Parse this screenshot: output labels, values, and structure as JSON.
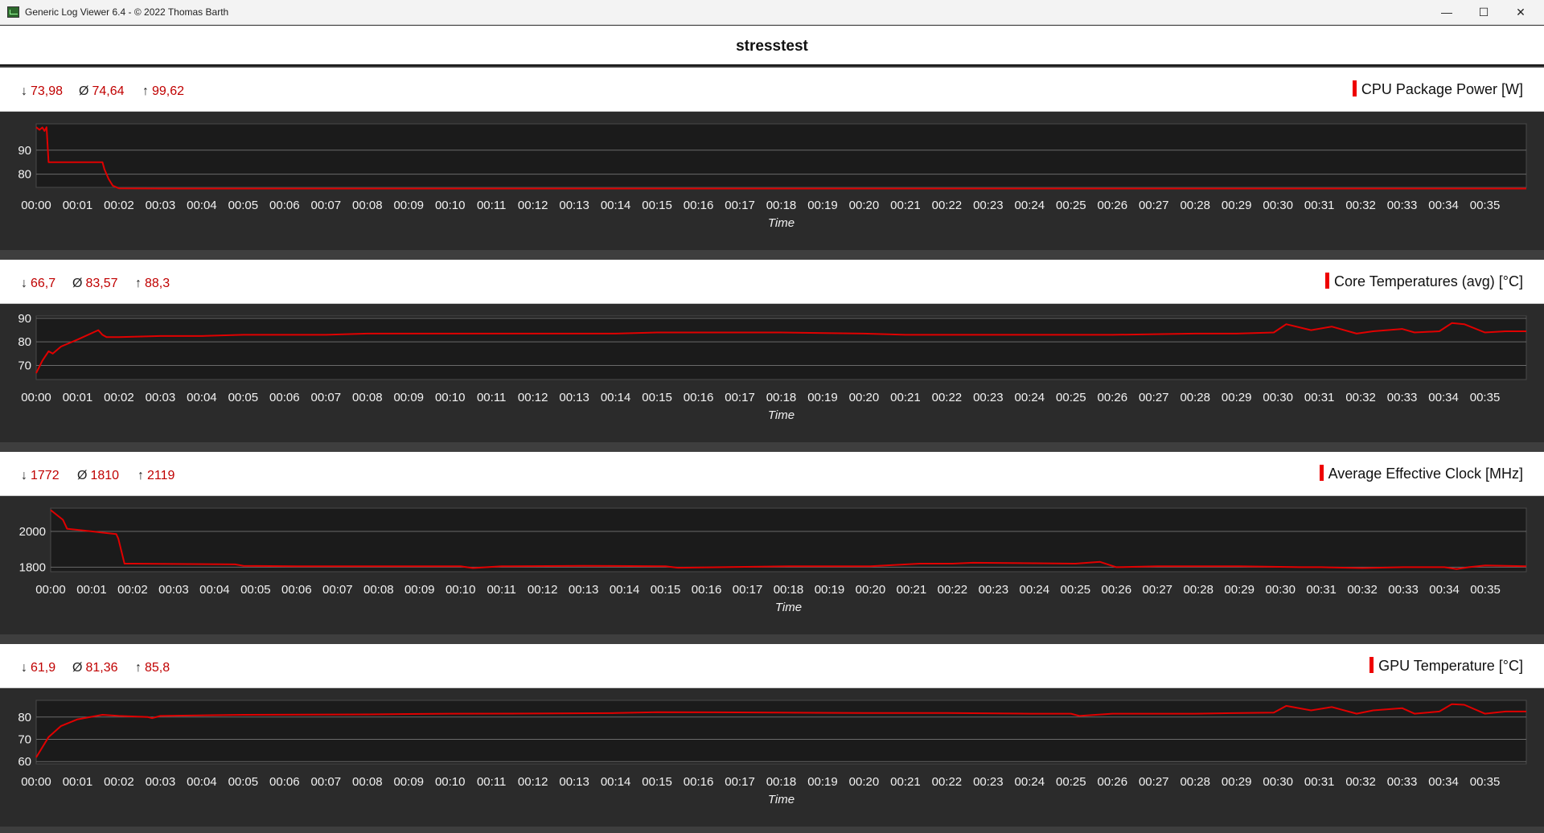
{
  "window": {
    "title": "Generic Log Viewer 6.4 - © 2022 Thomas Barth",
    "minimize": "—",
    "maximize": "☐",
    "close": "✕"
  },
  "log_name": "stresstest",
  "colors": {
    "series": "#e00000",
    "stats": "#c00000",
    "plot_bg": "#1b1b1b",
    "panel_bg": "#2b2b2b"
  },
  "panels": [
    {
      "series_label": "CPU Package Power [W]",
      "min": "73,98",
      "avg": "74,64",
      "max": "99,62"
    },
    {
      "series_label": "Core Temperatures (avg) [°C]",
      "min": "66,7",
      "avg": "83,57",
      "max": "88,3"
    },
    {
      "series_label": "Average Effective Clock [MHz]",
      "min": "1772",
      "avg": "1810",
      "max": "2119"
    },
    {
      "series_label": "GPU Temperature [°C]",
      "min": "61,9",
      "avg": "81,36",
      "max": "85,8"
    }
  ],
  "chart_data": [
    {
      "type": "line",
      "ylabel": "CPU Package Power [W]",
      "xlabel": "Time",
      "ylim": [
        74.5,
        101
      ],
      "yticks": [
        80,
        90
      ],
      "xlim": [
        0,
        36
      ],
      "xticks": [
        "00:00",
        "00:01",
        "00:02",
        "00:03",
        "00:04",
        "00:05",
        "00:06",
        "00:07",
        "00:08",
        "00:09",
        "00:10",
        "00:11",
        "00:12",
        "00:13",
        "00:14",
        "00:15",
        "00:16",
        "00:17",
        "00:18",
        "00:19",
        "00:20",
        "00:21",
        "00:22",
        "00:23",
        "00:24",
        "00:25",
        "00:26",
        "00:27",
        "00:28",
        "00:29",
        "00:30",
        "00:31",
        "00:32",
        "00:33",
        "00:34",
        "00:35"
      ],
      "grid": true,
      "series": [
        {
          "name": "CPU Package Power [W]",
          "x": [
            0,
            0.08,
            0.15,
            0.2,
            0.25,
            0.3,
            1.6,
            1.65,
            1.75,
            1.85,
            2,
            3,
            36
          ],
          "y": [
            99.6,
            98.5,
            99.5,
            98.0,
            99.6,
            85,
            85,
            82,
            78,
            75.2,
            74.1,
            74.0,
            74.0
          ]
        }
      ]
    },
    {
      "type": "line",
      "ylabel": "Core Temperatures (avg) [°C]",
      "xlabel": "Time",
      "ylim": [
        64,
        91
      ],
      "yticks": [
        70,
        80,
        90
      ],
      "xlim": [
        0,
        36
      ],
      "xticks": [
        "00:00",
        "00:01",
        "00:02",
        "00:03",
        "00:04",
        "00:05",
        "00:06",
        "00:07",
        "00:08",
        "00:09",
        "00:10",
        "00:11",
        "00:12",
        "00:13",
        "00:14",
        "00:15",
        "00:16",
        "00:17",
        "00:18",
        "00:19",
        "00:20",
        "00:21",
        "00:22",
        "00:23",
        "00:24",
        "00:25",
        "00:26",
        "00:27",
        "00:28",
        "00:29",
        "00:30",
        "00:31",
        "00:32",
        "00:33",
        "00:34",
        "00:35"
      ],
      "grid": true,
      "series": [
        {
          "name": "Core Temperatures (avg) [°C]",
          "x": [
            0,
            0.15,
            0.3,
            0.4,
            0.6,
            1,
            1.5,
            1.6,
            1.7,
            2,
            3,
            4,
            5,
            7,
            8,
            10,
            12,
            14,
            15,
            16,
            18,
            20,
            21,
            24,
            26,
            28,
            29,
            29.9,
            30.2,
            30.8,
            31.3,
            31.9,
            32.3,
            33,
            33.3,
            33.9,
            34.2,
            34.5,
            35,
            35.5,
            36
          ],
          "y": [
            66.7,
            72,
            76,
            75,
            78,
            81,
            85,
            83,
            82,
            82,
            82.5,
            82.5,
            83,
            83,
            83.5,
            83.5,
            83.5,
            83.5,
            84,
            84,
            84,
            83.5,
            83,
            83,
            83,
            83.5,
            83.5,
            84,
            87.5,
            85,
            86.5,
            83.5,
            84.5,
            85.5,
            84,
            84.5,
            88,
            87.5,
            84,
            84.5,
            84.5
          ]
        }
      ]
    },
    {
      "type": "line",
      "ylabel": "Average Effective Clock [MHz]",
      "xlabel": "Time",
      "ylim": [
        1775,
        2130
      ],
      "yticks": [
        1800,
        2000
      ],
      "xlim": [
        0,
        36
      ],
      "xticks": [
        "00:00",
        "00:01",
        "00:02",
        "00:03",
        "00:04",
        "00:05",
        "00:06",
        "00:07",
        "00:08",
        "00:09",
        "00:10",
        "00:11",
        "00:12",
        "00:13",
        "00:14",
        "00:15",
        "00:16",
        "00:17",
        "00:18",
        "00:19",
        "00:20",
        "00:21",
        "00:22",
        "00:23",
        "00:24",
        "00:25",
        "00:26",
        "00:27",
        "00:28",
        "00:29",
        "00:30",
        "00:31",
        "00:32",
        "00:33",
        "00:34",
        "00:35"
      ],
      "grid": true,
      "series": [
        {
          "name": "Average Effective Clock [MHz]",
          "x": [
            0,
            0.3,
            0.4,
            1,
            1.6,
            1.65,
            1.8,
            2,
            3,
            4.5,
            4.7,
            6,
            10,
            10.3,
            11,
            13,
            15,
            15.3,
            18,
            20,
            21.2,
            22,
            22.5,
            24,
            25,
            25.6,
            26,
            27,
            29,
            30.5,
            31,
            32,
            33,
            34,
            34.3,
            34.6,
            35,
            36
          ],
          "y": [
            2119,
            2065,
            2015,
            2000,
            1985,
            1960,
            1820,
            1820,
            1818,
            1816,
            1808,
            1805,
            1805,
            1795,
            1805,
            1808,
            1805,
            1797,
            1805,
            1805,
            1820,
            1820,
            1825,
            1822,
            1820,
            1830,
            1800,
            1805,
            1805,
            1800,
            1800,
            1795,
            1800,
            1800,
            1790,
            1800,
            1810,
            1805
          ]
        }
      ]
    },
    {
      "type": "line",
      "ylabel": "GPU Temperature [°C]",
      "xlabel": "Time",
      "ylim": [
        59,
        87.5
      ],
      "yticks": [
        60,
        70,
        80
      ],
      "xlim": [
        0,
        36
      ],
      "xticks": [
        "00:00",
        "00:01",
        "00:02",
        "00:03",
        "00:04",
        "00:05",
        "00:06",
        "00:07",
        "00:08",
        "00:09",
        "00:10",
        "00:11",
        "00:12",
        "00:13",
        "00:14",
        "00:15",
        "00:16",
        "00:17",
        "00:18",
        "00:19",
        "00:20",
        "00:21",
        "00:22",
        "00:23",
        "00:24",
        "00:25",
        "00:26",
        "00:27",
        "00:28",
        "00:29",
        "00:30",
        "00:31",
        "00:32",
        "00:33",
        "00:34",
        "00:35"
      ],
      "grid": true,
      "series": [
        {
          "name": "GPU Temperature [°C]",
          "x": [
            0,
            0.3,
            0.6,
            1,
            1.6,
            2,
            2.7,
            2.8,
            3,
            5,
            8,
            10,
            12,
            14,
            15,
            18,
            20,
            22,
            24,
            25,
            25.2,
            26,
            28,
            29.9,
            30.2,
            30.8,
            31.3,
            31.9,
            32.3,
            33,
            33.3,
            33.9,
            34.2,
            34.5,
            35,
            35.5,
            36
          ],
          "y": [
            61.9,
            71,
            76,
            79,
            81,
            80.5,
            80,
            79.5,
            80.5,
            81,
            81.2,
            81.5,
            81.6,
            81.8,
            82.2,
            82,
            81.8,
            81.8,
            81.5,
            81.5,
            80.5,
            81.5,
            81.5,
            82,
            85,
            83,
            84.5,
            81.5,
            83,
            84,
            81.5,
            82.5,
            85.8,
            85.5,
            81.5,
            82.5,
            82.5
          ]
        }
      ]
    }
  ]
}
